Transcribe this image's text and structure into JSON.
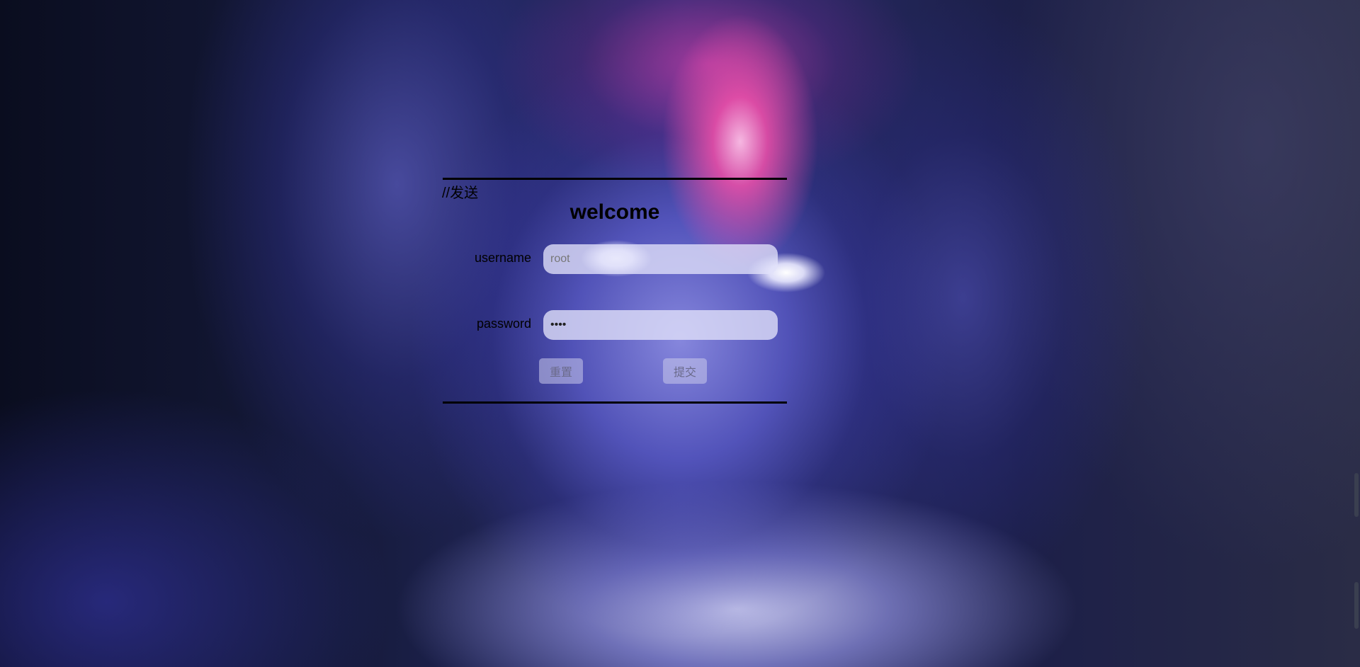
{
  "page": {
    "comment": "//发送",
    "title": "welcome"
  },
  "form": {
    "username_label": "username",
    "username_placeholder": "root",
    "password_label": "password",
    "password_value": "root",
    "reset_label": "重置",
    "submit_label": "提交"
  },
  "colors": {
    "divider": "#000000",
    "field_bg": "#e1e1fa",
    "button_bg": "#c8c8eb"
  }
}
